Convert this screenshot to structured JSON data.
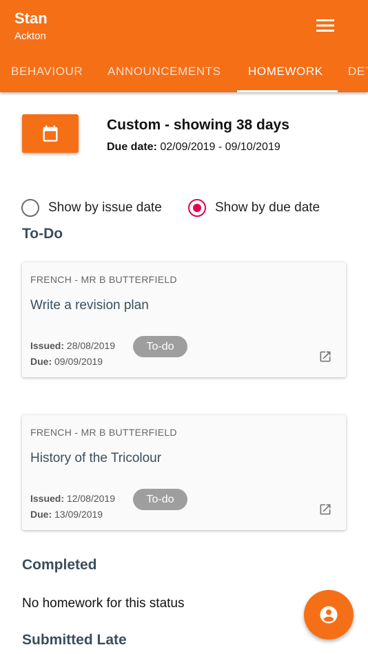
{
  "header": {
    "user_name": "Stan",
    "school": "Ackton",
    "menu_icon": "hamburger-menu-icon",
    "tabs": [
      {
        "label": "BEHAVIOUR",
        "active": false
      },
      {
        "label": "ANNOUNCEMENTS",
        "active": false
      },
      {
        "label": "HOMEWORK",
        "active": true
      },
      {
        "label": "DET",
        "active": false
      }
    ]
  },
  "filter": {
    "calendar_icon": "calendar-icon",
    "title": "Custom - showing 38 days",
    "due_label": "Due date:",
    "due_range": "02/09/2019 - 09/10/2019",
    "radio_issue": {
      "label": "Show by issue date",
      "checked": false
    },
    "radio_due": {
      "label": "Show by due date",
      "checked": true
    }
  },
  "sections": {
    "todo": {
      "heading": "To-Do",
      "cards": [
        {
          "subject": "FRENCH - MR B BUTTERFIELD",
          "title": "Write a revision plan",
          "issued_label": "Issued:",
          "issued": "28/08/2019",
          "due_label": "Due:",
          "due": "09/09/2019",
          "status": "To-do"
        },
        {
          "subject": "FRENCH - MR B BUTTERFIELD",
          "title": "History of the Tricolour",
          "issued_label": "Issued:",
          "issued": "12/08/2019",
          "due_label": "Due:",
          "due": "13/09/2019",
          "status": "To-do"
        }
      ]
    },
    "completed": {
      "heading": "Completed",
      "empty_text": "No homework for this status"
    },
    "late": {
      "heading": "Submitted Late"
    }
  },
  "colors": {
    "brand": "#f56f17",
    "radio_selected": "#e5004f",
    "badge": "#9e9e9e",
    "heading": "#3a4e5c"
  },
  "fab": {
    "icon": "account-circle-icon"
  }
}
